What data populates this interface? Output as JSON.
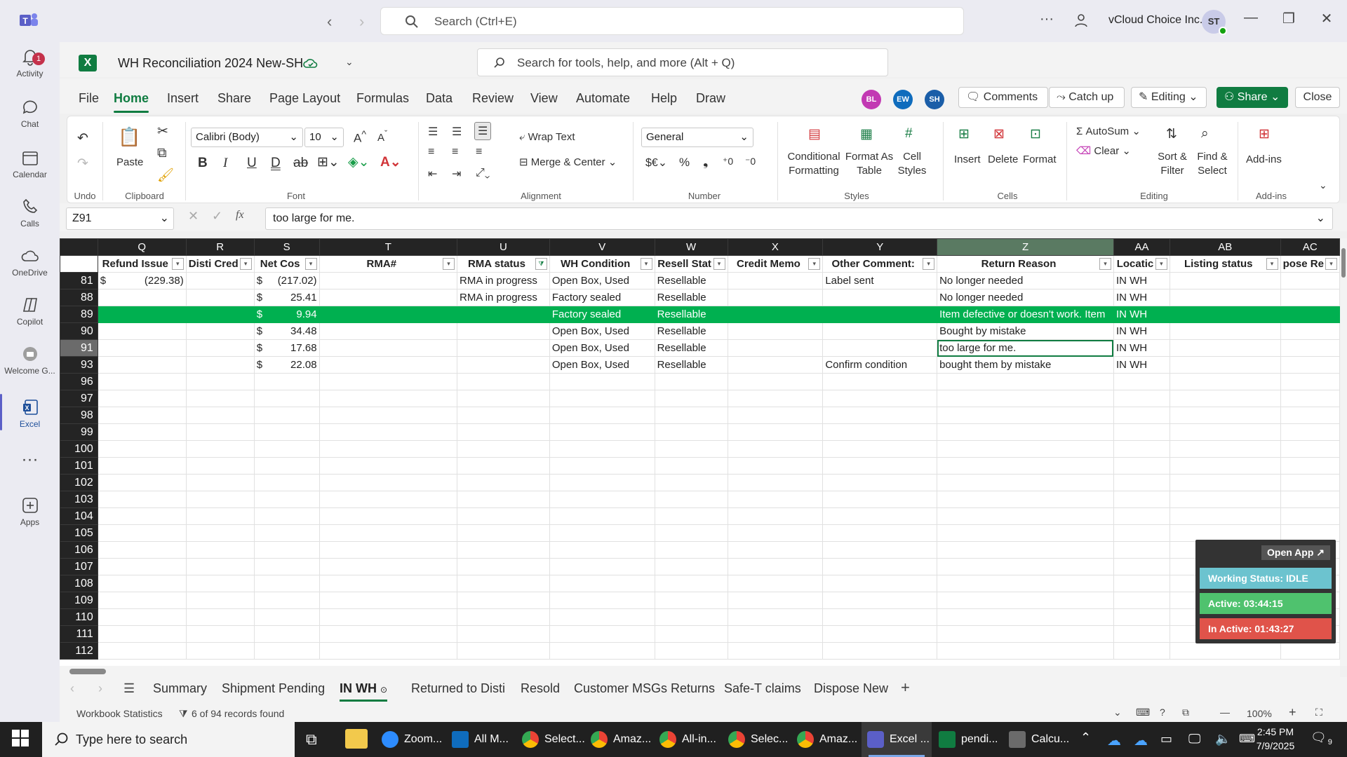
{
  "teams": {
    "search_placeholder": "Search (Ctrl+E)",
    "org_name": "vCloud Choice Inc.",
    "avatar_initials": "ST",
    "more": "···",
    "rail": [
      {
        "label": "Activity",
        "icon": "bell-icon"
      },
      {
        "label": "Chat",
        "icon": "chat-icon"
      },
      {
        "label": "Calendar",
        "icon": "calendar-icon"
      },
      {
        "label": "Calls",
        "icon": "phone-icon"
      },
      {
        "label": "OneDrive",
        "icon": "cloud-icon"
      },
      {
        "label": "Copilot",
        "icon": "copilot-icon"
      },
      {
        "label": "Welcome G...",
        "icon": "welcome-icon"
      },
      {
        "label": "Excel",
        "icon": "excel-icon"
      },
      {
        "label": "Apps",
        "icon": "plus-square-icon"
      }
    ],
    "activity_badge": "1"
  },
  "excel": {
    "workbook_name": "WH Reconciliation 2024 New-SH",
    "search_placeholder": "Search for tools, help, and more (Alt + Q)",
    "menu_tabs": [
      "File",
      "Home",
      "Insert",
      "Share",
      "Page Layout",
      "Formulas",
      "Data",
      "Review",
      "View",
      "Automate",
      "Help",
      "Draw"
    ],
    "collaborators": [
      {
        "initials": "BL",
        "color": "#c239b3"
      },
      {
        "initials": "EW",
        "color": "#0f6cbd"
      },
      {
        "initials": "SH",
        "color": "#1b5ea8"
      }
    ],
    "buttons": {
      "comments": "Comments",
      "catchup": "Catch up",
      "editing": "Editing",
      "share": "Share",
      "close": "Close"
    },
    "ribbon": {
      "groups": [
        "Undo",
        "Clipboard",
        "Font",
        "Alignment",
        "Number",
        "Styles",
        "Cells",
        "Editing",
        "Add-ins"
      ],
      "paste": "Paste",
      "font_name": "Calibri (Body)",
      "font_size": "10",
      "wrap_text": "Wrap Text",
      "merge_center": "Merge & Center",
      "number_format": "General",
      "cond_format": "Conditional Formatting",
      "format_table": "Format As Table",
      "cell_styles": "Cell Styles",
      "insert": "Insert",
      "delete": "Delete",
      "format": "Format",
      "autosum": "AutoSum",
      "clear": "Clear",
      "sort_filter": "Sort & Filter",
      "find_select": "Find & Select",
      "addins": "Add-ins",
      "currency": "$€",
      "percent": "%",
      "comma": "❟"
    },
    "name_box": "Z91",
    "formula": "too large for me.",
    "fx": "fx"
  },
  "grid": {
    "columns": [
      "Q",
      "R",
      "S",
      "T",
      "U",
      "V",
      "W",
      "X",
      "Y",
      "Z",
      "AA",
      "AB",
      "AC"
    ],
    "headers": [
      "Refund Issue",
      "Disti Cred",
      "Net Cos",
      "RMA#",
      "RMA status",
      "WH Condition",
      "Resell Stat",
      "Credit Memo",
      "Other Comment:",
      "Return Reason",
      "Locatic",
      "Listing status",
      "pose Re"
    ],
    "rows": [
      {
        "num": "81",
        "q_sym": "$",
        "q_val": "(229.38)",
        "s_sym": "$",
        "s_val": "(217.02)",
        "u": "RMA in progress",
        "v": "Open Box, Used",
        "w": "Resellable",
        "y": "Label sent",
        "z": "No longer needed",
        "aa": "IN WH"
      },
      {
        "num": "88",
        "q_sym": "",
        "q_val": "",
        "s_sym": "$",
        "s_val": "25.41",
        "u": "RMA in progress",
        "v": "Factory sealed",
        "w": "Resellable",
        "y": "",
        "z": "No longer needed",
        "aa": "IN WH"
      },
      {
        "num": "89",
        "q_sym": "",
        "q_val": "",
        "s_sym": "$",
        "s_val": "9.94",
        "u": "",
        "v": "Factory sealed",
        "w": "Resellable",
        "y": "",
        "z": "Item defective or doesn't work. Item",
        "aa": "IN WH"
      },
      {
        "num": "90",
        "q_sym": "",
        "q_val": "",
        "s_sym": "$",
        "s_val": "34.48",
        "u": "",
        "v": "Open Box, Used",
        "w": "Resellable",
        "y": "",
        "z": "Bought by mistake",
        "aa": "IN WH"
      },
      {
        "num": "91",
        "q_sym": "",
        "q_val": "",
        "s_sym": "$",
        "s_val": "17.68",
        "u": "",
        "v": "Open Box, Used",
        "w": "Resellable",
        "y": "",
        "z": "too large for me.",
        "aa": "IN WH"
      },
      {
        "num": "93",
        "q_sym": "",
        "q_val": "",
        "s_sym": "$",
        "s_val": "22.08",
        "u": "",
        "v": "Open Box, Used",
        "w": "Resellable",
        "y": "Confirm condition",
        "z": "bought them by mistake",
        "aa": "IN WH"
      }
    ],
    "empty_rows": [
      "96",
      "97",
      "98",
      "99",
      "100",
      "101",
      "102",
      "103",
      "104",
      "105",
      "106",
      "107",
      "108",
      "109",
      "110",
      "111",
      "112"
    ],
    "header_row_num": "1"
  },
  "widget": {
    "open_app": "Open App ↗",
    "working": "Working Status: IDLE",
    "active": "Active: 03:44:15",
    "inactive": "In Active: 01:43:27"
  },
  "sheets": [
    "Summary",
    "Shipment Pending",
    "IN WH",
    "Returned to Disti",
    "Resold",
    "Customer MSGs Returns",
    "Safe-T claims",
    "Dispose New"
  ],
  "status": {
    "stats": "Workbook Statistics",
    "records": "6 of 94 records found",
    "zoom": "100%"
  },
  "taskbar": {
    "search": "Type here to search",
    "apps": [
      {
        "label": "Zoom...",
        "color": "#2d8cff"
      },
      {
        "label": "All M...",
        "color": "#0f6cbd"
      },
      {
        "label": "Select...",
        "color": "#34a853"
      },
      {
        "label": "Amaz...",
        "color": "#ea4335"
      },
      {
        "label": "All-in...",
        "color": "#fbbc05"
      },
      {
        "label": "Selec...",
        "color": "#34a853"
      },
      {
        "label": "Amaz...",
        "color": "#ea4335"
      },
      {
        "label": "Excel ...",
        "color": "#5b5fc7"
      },
      {
        "label": "pendi...",
        "color": "#107c41"
      },
      {
        "label": "Calcu...",
        "color": "#6b6b6b"
      }
    ],
    "time": "2:45 PM",
    "date": "7/9/2025",
    "notif": "9"
  }
}
